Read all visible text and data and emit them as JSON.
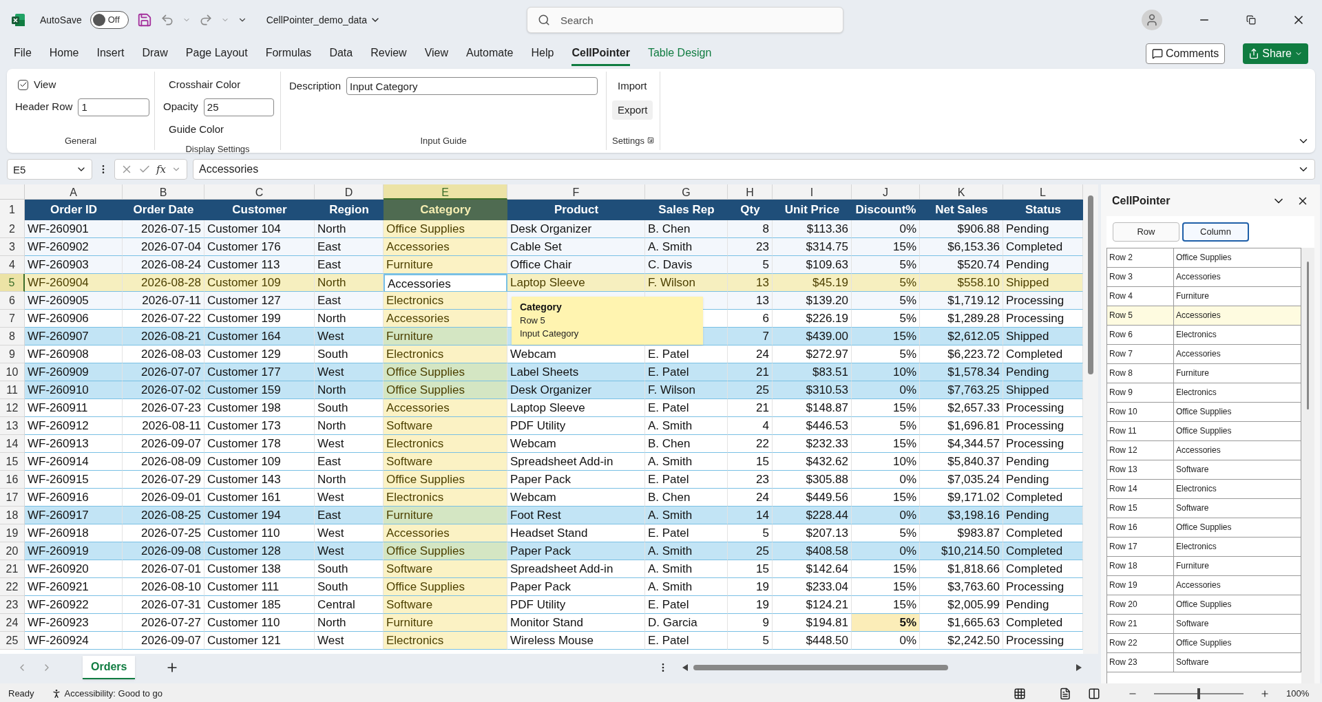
{
  "titlebar": {
    "autosave_label": "AutoSave",
    "autosave": {
      "on": false,
      "label": "Off"
    },
    "file_name": "CellPointer_demo_data",
    "search": {
      "placeholder": "Search"
    }
  },
  "tabs": [
    {
      "label": "File",
      "selected": false,
      "contextual": false
    },
    {
      "label": "Home",
      "selected": false,
      "contextual": false
    },
    {
      "label": "Insert",
      "selected": false,
      "contextual": false
    },
    {
      "label": "Draw",
      "selected": false,
      "contextual": false
    },
    {
      "label": "Page Layout",
      "selected": false,
      "contextual": false
    },
    {
      "label": "Formulas",
      "selected": false,
      "contextual": false
    },
    {
      "label": "Data",
      "selected": false,
      "contextual": false
    },
    {
      "label": "Review",
      "selected": false,
      "contextual": false
    },
    {
      "label": "View",
      "selected": false,
      "contextual": false
    },
    {
      "label": "Automate",
      "selected": false,
      "contextual": false
    },
    {
      "label": "Help",
      "selected": false,
      "contextual": false
    },
    {
      "label": "CellPointer",
      "selected": true,
      "contextual": false
    },
    {
      "label": "Table Design",
      "selected": false,
      "contextual": true
    }
  ],
  "actions": {
    "comments": "Comments",
    "share": "Share"
  },
  "ribbon": {
    "general": {
      "title": "General",
      "view": {
        "label": "View",
        "checked": true
      },
      "header_row": {
        "label": "Header Row",
        "value": "1"
      }
    },
    "display": {
      "title": "Display Settings",
      "crosshair": "Crosshair Color",
      "opacity": {
        "label": "Opacity",
        "value": "25"
      },
      "guide": "Guide Color"
    },
    "input_guide": {
      "title": "Input Guide",
      "description": {
        "label": "Description",
        "value": "Input Category"
      }
    },
    "settings": {
      "title": "Settings",
      "import": "Import",
      "export": "Export"
    }
  },
  "formula_bar": {
    "name_box": "E5",
    "function_label": "fx",
    "value": "Accessories"
  },
  "sheet": {
    "columns": [
      {
        "letter": "A",
        "selected": false
      },
      {
        "letter": "B",
        "selected": false
      },
      {
        "letter": "C",
        "selected": false
      },
      {
        "letter": "D",
        "selected": false
      },
      {
        "letter": "E",
        "selected": true
      },
      {
        "letter": "F",
        "selected": false
      },
      {
        "letter": "G",
        "selected": false
      },
      {
        "letter": "H",
        "selected": false
      },
      {
        "letter": "I",
        "selected": false
      },
      {
        "letter": "J",
        "selected": false
      },
      {
        "letter": "K",
        "selected": false
      },
      {
        "letter": "L",
        "selected": false
      }
    ],
    "header_row": {
      "number": "1",
      "cells": [
        "Order ID",
        "Order Date",
        "Customer",
        "Region",
        "Category",
        "Product",
        "Sales Rep",
        "Qty",
        "Unit Price",
        "Discount%",
        "Net Sales",
        "Status"
      ]
    },
    "rows": [
      {
        "number": "2",
        "kind": "light",
        "selected": false,
        "cells": [
          "WF-260901",
          "2026-07-15",
          "Customer 104",
          "North",
          "Office Supplies",
          "Desk Organizer",
          "B. Chen",
          "8",
          "$113.36",
          "0%",
          "$906.88",
          "Pending"
        ]
      },
      {
        "number": "3",
        "kind": "light",
        "selected": false,
        "cells": [
          "WF-260902",
          "2026-07-04",
          "Customer 176",
          "East",
          "Accessories",
          "Cable Set",
          "A. Smith",
          "23",
          "$314.75",
          "15%",
          "$6,153.36",
          "Completed"
        ]
      },
      {
        "number": "4",
        "kind": "light",
        "selected": false,
        "cells": [
          "WF-260903",
          "2026-08-24",
          "Customer 113",
          "East",
          "Furniture",
          "Office Chair",
          "C. Davis",
          "5",
          "$109.63",
          "5%",
          "$520.74",
          "Pending"
        ]
      },
      {
        "number": "5",
        "kind": "light",
        "selected": true,
        "cells": [
          "WF-260904",
          "2026-08-28",
          "Customer 109",
          "North",
          "Accessories",
          "Laptop Sleeve",
          "F. Wilson",
          "13",
          "$45.19",
          "5%",
          "$558.10",
          "Shipped"
        ]
      },
      {
        "number": "6",
        "kind": "light",
        "selected": false,
        "cells": [
          "WF-260905",
          "2026-07-11",
          "Customer 127",
          "East",
          "Electronics",
          null,
          null,
          "13",
          "$139.20",
          "5%",
          "$1,719.12",
          "Processing"
        ]
      },
      {
        "number": "7",
        "kind": "plain",
        "selected": false,
        "cells": [
          "WF-260906",
          "2026-07-22",
          "Customer 199",
          "North",
          "Accessories",
          null,
          null,
          "6",
          "$226.19",
          "5%",
          "$1,289.28",
          "Processing"
        ]
      },
      {
        "number": "8",
        "kind": "blue",
        "selected": false,
        "cells": [
          "WF-260907",
          "2026-08-21",
          "Customer 164",
          "West",
          "Furniture",
          null,
          null,
          "7",
          "$439.00",
          "15%",
          "$2,612.05",
          "Shipped"
        ]
      },
      {
        "number": "9",
        "kind": "plain",
        "selected": false,
        "cells": [
          "WF-260908",
          "2026-08-03",
          "Customer 129",
          "South",
          "Electronics",
          "Webcam",
          "E. Patel",
          "24",
          "$272.97",
          "5%",
          "$6,223.72",
          "Completed"
        ]
      },
      {
        "number": "10",
        "kind": "blue",
        "selected": false,
        "cells": [
          "WF-260909",
          "2026-07-07",
          "Customer 177",
          "West",
          "Office Supplies",
          "Label Sheets",
          "E. Patel",
          "21",
          "$83.51",
          "10%",
          "$1,578.34",
          "Pending"
        ]
      },
      {
        "number": "11",
        "kind": "blue",
        "selected": false,
        "cells": [
          "WF-260910",
          "2026-07-02",
          "Customer 159",
          "North",
          "Office Supplies",
          "Desk Organizer",
          "F. Wilson",
          "25",
          "$310.53",
          "0%",
          "$7,763.25",
          "Shipped"
        ]
      },
      {
        "number": "12",
        "kind": "plain",
        "selected": false,
        "cells": [
          "WF-260911",
          "2026-07-23",
          "Customer 198",
          "South",
          "Accessories",
          "Laptop Sleeve",
          "E. Patel",
          "21",
          "$148.87",
          "15%",
          "$2,657.33",
          "Processing"
        ]
      },
      {
        "number": "13",
        "kind": "plain",
        "selected": false,
        "cells": [
          "WF-260912",
          "2026-08-11",
          "Customer 173",
          "North",
          "Software",
          "PDF Utility",
          "A. Smith",
          "4",
          "$446.53",
          "5%",
          "$1,696.81",
          "Processing"
        ]
      },
      {
        "number": "14",
        "kind": "plain",
        "selected": false,
        "cells": [
          "WF-260913",
          "2026-09-07",
          "Customer 178",
          "West",
          "Electronics",
          "Webcam",
          "B. Chen",
          "22",
          "$232.33",
          "15%",
          "$4,344.57",
          "Processing"
        ]
      },
      {
        "number": "15",
        "kind": "plain",
        "selected": false,
        "cells": [
          "WF-260914",
          "2026-08-09",
          "Customer 109",
          "East",
          "Software",
          "Spreadsheet Add-in",
          "A. Smith",
          "15",
          "$432.62",
          "10%",
          "$5,840.37",
          "Pending"
        ]
      },
      {
        "number": "16",
        "kind": "plain",
        "selected": false,
        "cells": [
          "WF-260915",
          "2026-07-29",
          "Customer 143",
          "North",
          "Office Supplies",
          "Paper Pack",
          "E. Patel",
          "23",
          "$305.88",
          "0%",
          "$7,035.24",
          "Pending"
        ]
      },
      {
        "number": "17",
        "kind": "plain",
        "selected": false,
        "cells": [
          "WF-260916",
          "2026-09-01",
          "Customer 161",
          "West",
          "Electronics",
          "Webcam",
          "B. Chen",
          "24",
          "$449.56",
          "15%",
          "$9,171.02",
          "Completed"
        ]
      },
      {
        "number": "18",
        "kind": "blue",
        "selected": false,
        "cells": [
          "WF-260917",
          "2026-08-25",
          "Customer 194",
          "East",
          "Furniture",
          "Foot Rest",
          "A. Smith",
          "14",
          "$228.44",
          "0%",
          "$3,198.16",
          "Pending"
        ]
      },
      {
        "number": "19",
        "kind": "plain",
        "selected": false,
        "cells": [
          "WF-260918",
          "2026-07-25",
          "Customer 110",
          "West",
          "Accessories",
          "Headset Stand",
          "E. Patel",
          "5",
          "$207.13",
          "5%",
          "$983.87",
          "Completed"
        ]
      },
      {
        "number": "20",
        "kind": "blue",
        "selected": false,
        "cells": [
          "WF-260919",
          "2026-09-08",
          "Customer 128",
          "West",
          "Office Supplies",
          "Paper Pack",
          "A. Smith",
          "25",
          "$408.58",
          "0%",
          "$10,214.50",
          "Completed"
        ]
      },
      {
        "number": "21",
        "kind": "plain",
        "selected": false,
        "cells": [
          "WF-260920",
          "2026-07-01",
          "Customer 138",
          "South",
          "Software",
          "Spreadsheet Add-in",
          "A. Smith",
          "15",
          "$142.64",
          "15%",
          "$1,818.66",
          "Completed"
        ]
      },
      {
        "number": "22",
        "kind": "plain",
        "selected": false,
        "cells": [
          "WF-260921",
          "2026-08-10",
          "Customer 111",
          "South",
          "Office Supplies",
          "Paper Pack",
          "A. Smith",
          "19",
          "$233.04",
          "15%",
          "$3,763.60",
          "Processing"
        ]
      },
      {
        "number": "23",
        "kind": "plain",
        "selected": false,
        "cells": [
          "WF-260922",
          "2026-07-31",
          "Customer 185",
          "Central",
          "Software",
          "PDF Utility",
          "E. Patel",
          "19",
          "$124.21",
          "15%",
          "$2,005.99",
          "Pending"
        ]
      },
      {
        "number": "24",
        "kind": "plain",
        "selected": false,
        "cells": [
          "WF-260923",
          "2026-07-27",
          "Customer 110",
          "North",
          "Furniture",
          "Monitor Stand",
          "D. Garcia",
          "9",
          "$194.81",
          {
            "text": "5%",
            "flagged": true
          },
          "$1,665.63",
          "Completed"
        ]
      },
      {
        "number": "25",
        "kind": "plain",
        "selected": false,
        "cells": [
          "WF-260924",
          "2026-09-07",
          "Customer 121",
          "West",
          "Electronics",
          "Wireless Mouse",
          "E. Patel",
          "5",
          "$448.50",
          "0%",
          "$2,242.50",
          "Processing"
        ]
      }
    ]
  },
  "tooltip": {
    "title": "Category",
    "row": "Row 5",
    "description": "Input Category"
  },
  "panel": {
    "title": "CellPointer",
    "modes": [
      {
        "label": "Row",
        "selected": false
      },
      {
        "label": "Column",
        "selected": true
      }
    ],
    "items": [
      {
        "row": "Row 2",
        "value": "Office Supplies",
        "selected": false
      },
      {
        "row": "Row 3",
        "value": "Accessories",
        "selected": false
      },
      {
        "row": "Row 4",
        "value": "Furniture",
        "selected": false
      },
      {
        "row": "Row 5",
        "value": "Accessories",
        "selected": true
      },
      {
        "row": "Row 6",
        "value": "Electronics",
        "selected": false
      },
      {
        "row": "Row 7",
        "value": "Accessories",
        "selected": false
      },
      {
        "row": "Row 8",
        "value": "Furniture",
        "selected": false
      },
      {
        "row": "Row 9",
        "value": "Electronics",
        "selected": false
      },
      {
        "row": "Row 10",
        "value": "Office Supplies",
        "selected": false
      },
      {
        "row": "Row 11",
        "value": "Office Supplies",
        "selected": false
      },
      {
        "row": "Row 12",
        "value": "Accessories",
        "selected": false
      },
      {
        "row": "Row 13",
        "value": "Software",
        "selected": false
      },
      {
        "row": "Row 14",
        "value": "Electronics",
        "selected": false
      },
      {
        "row": "Row 15",
        "value": "Software",
        "selected": false
      },
      {
        "row": "Row 16",
        "value": "Office Supplies",
        "selected": false
      },
      {
        "row": "Row 17",
        "value": "Electronics",
        "selected": false
      },
      {
        "row": "Row 18",
        "value": "Furniture",
        "selected": false
      },
      {
        "row": "Row 19",
        "value": "Accessories",
        "selected": false
      },
      {
        "row": "Row 20",
        "value": "Office Supplies",
        "selected": false
      },
      {
        "row": "Row 21",
        "value": "Software",
        "selected": false
      },
      {
        "row": "Row 22",
        "value": "Office Supplies",
        "selected": false
      },
      {
        "row": "Row 23",
        "value": "Software",
        "selected": false
      }
    ]
  },
  "sheet_tabs": [
    {
      "label": "Orders",
      "selected": true
    }
  ],
  "status_bar": {
    "ready": "Ready",
    "accessibility": "Accessibility: Good to go",
    "zoom": {
      "level": 0.5,
      "reading": "100%"
    }
  }
}
